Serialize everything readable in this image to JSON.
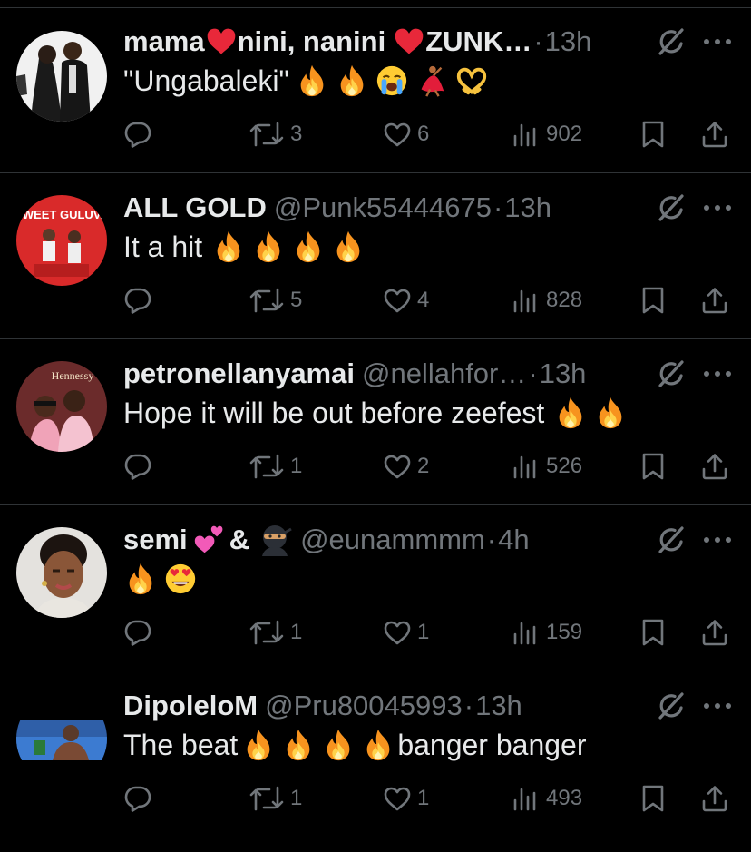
{
  "tweets": [
    {
      "name": "mama",
      "name_parts": [
        "nini, nanini",
        "ZUNK…"
      ],
      "handle": "",
      "time": "13h",
      "text": "\"Ungabaleki\"",
      "body_emojis": [
        "fire-emoji",
        "fire-emoji",
        "loudly-crying-face-emoji",
        "dancer-emoji",
        "heart-hands-emoji"
      ],
      "retweets": "3",
      "likes": "6",
      "views": "902"
    },
    {
      "name": "ALL GOLD",
      "handle": "@Punk55444675",
      "time": "13h",
      "text": "It a hit",
      "body_emojis": [
        "fire-emoji",
        "fire-emoji",
        "fire-emoji",
        "fire-emoji"
      ],
      "avatar_text": "SWEET GULUVA",
      "retweets": "5",
      "likes": "4",
      "views": "828"
    },
    {
      "name": "petronellanyamai",
      "handle": "@nellahfor…",
      "time": "13h",
      "text": "Hope it will be out before zeefest",
      "body_emojis": [
        "fire-emoji",
        "fire-emoji"
      ],
      "avatar_text": "Hennessy",
      "retweets": "1",
      "likes": "2",
      "views": "526"
    },
    {
      "name": "semi",
      "name_mid": "&",
      "handle": "@eunammmm",
      "time": "4h",
      "text": "",
      "body_emojis": [
        "fire-emoji",
        "heart-eyes-emoji"
      ],
      "retweets": "1",
      "likes": "1",
      "views": "159"
    },
    {
      "name": "DipoleloM",
      "handle": "@Pru80045993",
      "time": "13h",
      "text": "The beat",
      "text_after": "banger banger",
      "body_emojis": [
        "fire-emoji",
        "fire-emoji",
        "fire-emoji",
        "fire-emoji"
      ],
      "retweets": "1",
      "likes": "1",
      "views": "493"
    }
  ],
  "icons": {
    "reply": "reply-icon",
    "retweet": "retweet-icon",
    "like": "heart-icon",
    "views": "views-icon",
    "bookmark": "bookmark-icon",
    "share": "share-icon",
    "grok": "grok-icon",
    "more": "more-icon"
  },
  "colors": {
    "background": "#000000",
    "text": "#e7e9ea",
    "secondary": "#71767b",
    "divider": "#2f3336",
    "red_heart": "#e8283a",
    "fire": "#f7931e"
  }
}
